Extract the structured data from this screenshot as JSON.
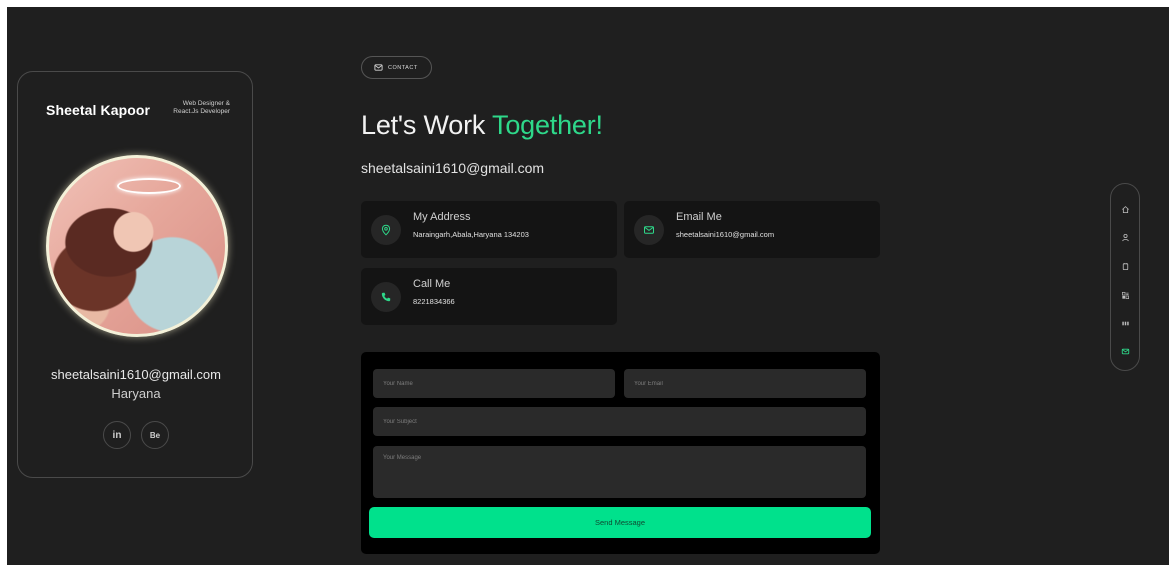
{
  "profile": {
    "name": "Sheetal Kapoor",
    "role": "Web Designer & React.Js Developer",
    "email": "sheetalsaini1610@gmail.com",
    "location": "Haryana",
    "social": [
      {
        "label": "in",
        "icon": "linkedin-icon"
      },
      {
        "label": "Be",
        "icon": "behance-icon"
      }
    ]
  },
  "section_pill": {
    "label": "CONTACT",
    "icon": "mail-icon"
  },
  "heading": {
    "prefix": "Let's Work ",
    "accent": "Together!"
  },
  "contact_email": "sheetalsaini1610@gmail.com",
  "info_cards": {
    "address": {
      "title": "My Address",
      "value": "Naraingarh,Abala,Haryana 134203",
      "icon": "location-pin-icon"
    },
    "email": {
      "title": "Email Me",
      "value": "sheetalsaini1610@gmail.com",
      "icon": "mail-icon"
    },
    "call": {
      "title": "Call Me",
      "value": "8221834366",
      "icon": "phone-icon"
    }
  },
  "form": {
    "name_placeholder": "Your Name",
    "email_placeholder": "Your Email",
    "subject_placeholder": "Your Subject",
    "message_placeholder": "Your Message",
    "submit_label": "Send Message"
  },
  "sidenav": {
    "items": [
      "home-icon",
      "user-icon",
      "document-icon",
      "services-icon",
      "portfolio-icon",
      "contact-mail-icon"
    ],
    "active": "contact-mail-icon"
  },
  "colors": {
    "accent": "#2ed88a",
    "button": "#00e18c",
    "background": "#1f1f1f",
    "card": "#141414"
  }
}
